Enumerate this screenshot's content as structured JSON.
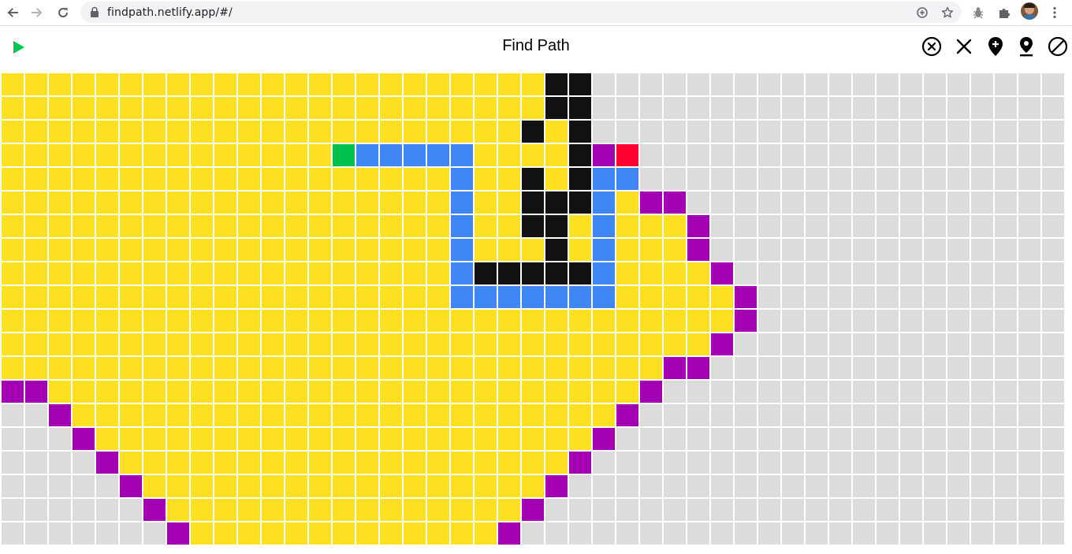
{
  "browser": {
    "url": "findpath.netlify.app/#/",
    "icons": [
      "back-arrow-icon",
      "forward-arrow-icon",
      "reload-icon",
      "lock-icon",
      "add-icon",
      "bookmark-star-icon",
      "bug-extension-icon",
      "puzzle-extension-icon",
      "avatar",
      "kebab-menu-icon"
    ]
  },
  "app": {
    "title": "Find Path",
    "toolbar_icons": [
      "play-icon",
      "clear-all-icon",
      "close-icon",
      "add-marker-icon",
      "set-target-icon",
      "block-icon"
    ],
    "accent_color": "#00c853"
  },
  "grid": {
    "rows": 20,
    "cols": 45,
    "colors": {
      "empty": "#dcdcdc",
      "visited": "#fde021",
      "wall": "#111111",
      "path": "#3f87f5",
      "frontier": "#a300b4",
      "start": "#00c050",
      "end": "#ff0030"
    },
    "visited_ranges": [
      [
        [
          0,
          22
        ]
      ],
      [
        [
          0,
          22
        ]
      ],
      [
        [
          0,
          21
        ],
        [
          23,
          23
        ]
      ],
      [
        [
          0,
          23
        ]
      ],
      [
        [
          0,
          23
        ],
        [
          26,
          26
        ]
      ],
      [
        [
          0,
          26
        ]
      ],
      [
        [
          0,
          28
        ]
      ],
      [
        [
          0,
          28
        ]
      ],
      [
        [
          0,
          29
        ]
      ],
      [
        [
          0,
          30
        ]
      ],
      [
        [
          0,
          30
        ]
      ],
      [
        [
          0,
          29
        ]
      ],
      [
        [
          0,
          27
        ]
      ],
      [
        [
          2,
          26
        ]
      ],
      [
        [
          3,
          25
        ]
      ],
      [
        [
          4,
          24
        ]
      ],
      [
        [
          5,
          23
        ]
      ],
      [
        [
          6,
          22
        ]
      ],
      [
        [
          7,
          21
        ]
      ],
      [
        [
          8,
          20
        ]
      ]
    ],
    "walls": [
      [
        0,
        23
      ],
      [
        0,
        24
      ],
      [
        1,
        23
      ],
      [
        1,
        24
      ],
      [
        2,
        22
      ],
      [
        2,
        24
      ],
      [
        3,
        24
      ],
      [
        4,
        22
      ],
      [
        4,
        24
      ],
      [
        5,
        22
      ],
      [
        5,
        23
      ],
      [
        5,
        24
      ],
      [
        6,
        22
      ],
      [
        6,
        23
      ],
      [
        7,
        23
      ],
      [
        8,
        20
      ],
      [
        8,
        21
      ],
      [
        8,
        22
      ],
      [
        8,
        23
      ],
      [
        8,
        24
      ]
    ],
    "path": [
      [
        3,
        15
      ],
      [
        3,
        16
      ],
      [
        3,
        17
      ],
      [
        3,
        18
      ],
      [
        3,
        19
      ],
      [
        4,
        19
      ],
      [
        5,
        19
      ],
      [
        6,
        19
      ],
      [
        7,
        19
      ],
      [
        8,
        19
      ],
      [
        9,
        19
      ],
      [
        9,
        20
      ],
      [
        9,
        21
      ],
      [
        9,
        22
      ],
      [
        9,
        23
      ],
      [
        9,
        24
      ],
      [
        9,
        25
      ],
      [
        8,
        25
      ],
      [
        7,
        25
      ],
      [
        6,
        25
      ],
      [
        5,
        25
      ],
      [
        4,
        25
      ],
      [
        4,
        26
      ]
    ],
    "frontier": [
      [
        3,
        25
      ],
      [
        5,
        27
      ],
      [
        5,
        28
      ],
      [
        6,
        29
      ],
      [
        7,
        29
      ],
      [
        8,
        30
      ],
      [
        9,
        31
      ],
      [
        10,
        31
      ],
      [
        11,
        30
      ],
      [
        12,
        28
      ],
      [
        12,
        29
      ],
      [
        13,
        0
      ],
      [
        13,
        1
      ],
      [
        13,
        27
      ],
      [
        14,
        2
      ],
      [
        14,
        26
      ],
      [
        15,
        3
      ],
      [
        15,
        25
      ],
      [
        16,
        4
      ],
      [
        16,
        24
      ],
      [
        17,
        5
      ],
      [
        17,
        23
      ],
      [
        18,
        6
      ],
      [
        18,
        22
      ],
      [
        19,
        7
      ],
      [
        19,
        21
      ]
    ],
    "start": [
      3,
      14
    ],
    "end": [
      3,
      26
    ]
  }
}
